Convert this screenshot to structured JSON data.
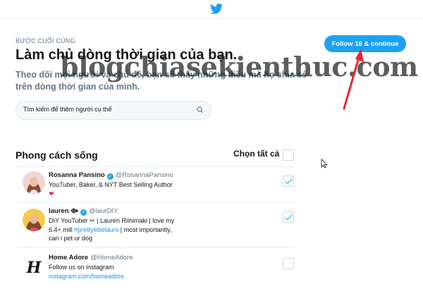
{
  "header": {
    "logo_icon": "twitter-bird-icon",
    "brand_color": "#1da1f2"
  },
  "page": {
    "step_label": "BƯỚC CUỐI CÙNG",
    "title": "Làm chủ dòng thời gian của bạn.",
    "description": "Theo dõi mọi người và chủ đề, bạn sẽ thấy những điều mà họ chia sẻ trên dòng thời gian của mình."
  },
  "follow_button": {
    "label": "Follow 16 & continue"
  },
  "watermark": {
    "text": "blogchiasekienthuc.com"
  },
  "search": {
    "placeholder": "Tìm kiếm để thêm người cụ thể",
    "icon": "search-icon"
  },
  "section": {
    "title": "Phong cách sống",
    "select_all_label": "Chọn tất cả",
    "select_all_checked": false
  },
  "accounts": [
    {
      "name": "Rosanna Pansino",
      "verified": true,
      "handle": "@RosannaPansino",
      "bio_line1": "YouTuber, Baker, & NYT Best Selling Author",
      "bio_line2": "❤",
      "checked": true
    },
    {
      "name": "lauren ⟴",
      "verified": true,
      "handle": "@laurDIY",
      "bio_line1": "DIY YouTuber ✂ | Lauren Riihimaki | love my",
      "bio_line2_pre": "6.4+ mill ",
      "bio_line2_link": "#prettylittlelaurs",
      "bio_line2_post": " | most importantly,",
      "bio_line3": "can i pet ur dog",
      "checked": true
    },
    {
      "name": "Home Adore",
      "verified": false,
      "handle": "@HomeAdore",
      "bio_line1": "Follow us on instagram",
      "bio_link": "instagram.com/homeadore",
      "checked": false
    }
  ]
}
